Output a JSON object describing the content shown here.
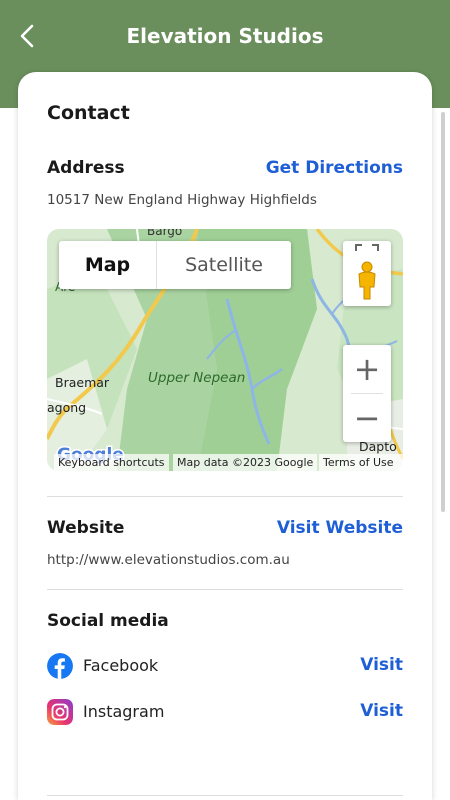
{
  "header": {
    "title": "Elevation Studios"
  },
  "contact": {
    "heading": "Contact",
    "address_label": "Address",
    "get_directions": "Get Directions",
    "address": "10517 New England Highway Highfields"
  },
  "map": {
    "type_map": "Map",
    "type_satellite": "Satellite",
    "zoom_in": "+",
    "zoom_out": "−",
    "places": {
      "bargo": "Bargo",
      "upper_nepean": "Upper Nepean",
      "braemar": "Braemar",
      "agong": "agong",
      "dapto": "Dapto",
      "are": "Are"
    },
    "attribution": {
      "shortcuts": "Keyboard shortcuts",
      "data": "Map data ©2023 Google",
      "terms": "Terms of Use"
    },
    "logo": "Google"
  },
  "website": {
    "label": "Website",
    "visit": "Visit Website",
    "url": "http://www.elevationstudios.com.au"
  },
  "social": {
    "heading": "Social media",
    "items": [
      {
        "name": "Facebook",
        "action": "Visit"
      },
      {
        "name": "Instagram",
        "action": "Visit"
      }
    ]
  },
  "colors": {
    "header": "#6a8f5c",
    "link": "#1f5fd6",
    "facebook": "#1877f2"
  }
}
